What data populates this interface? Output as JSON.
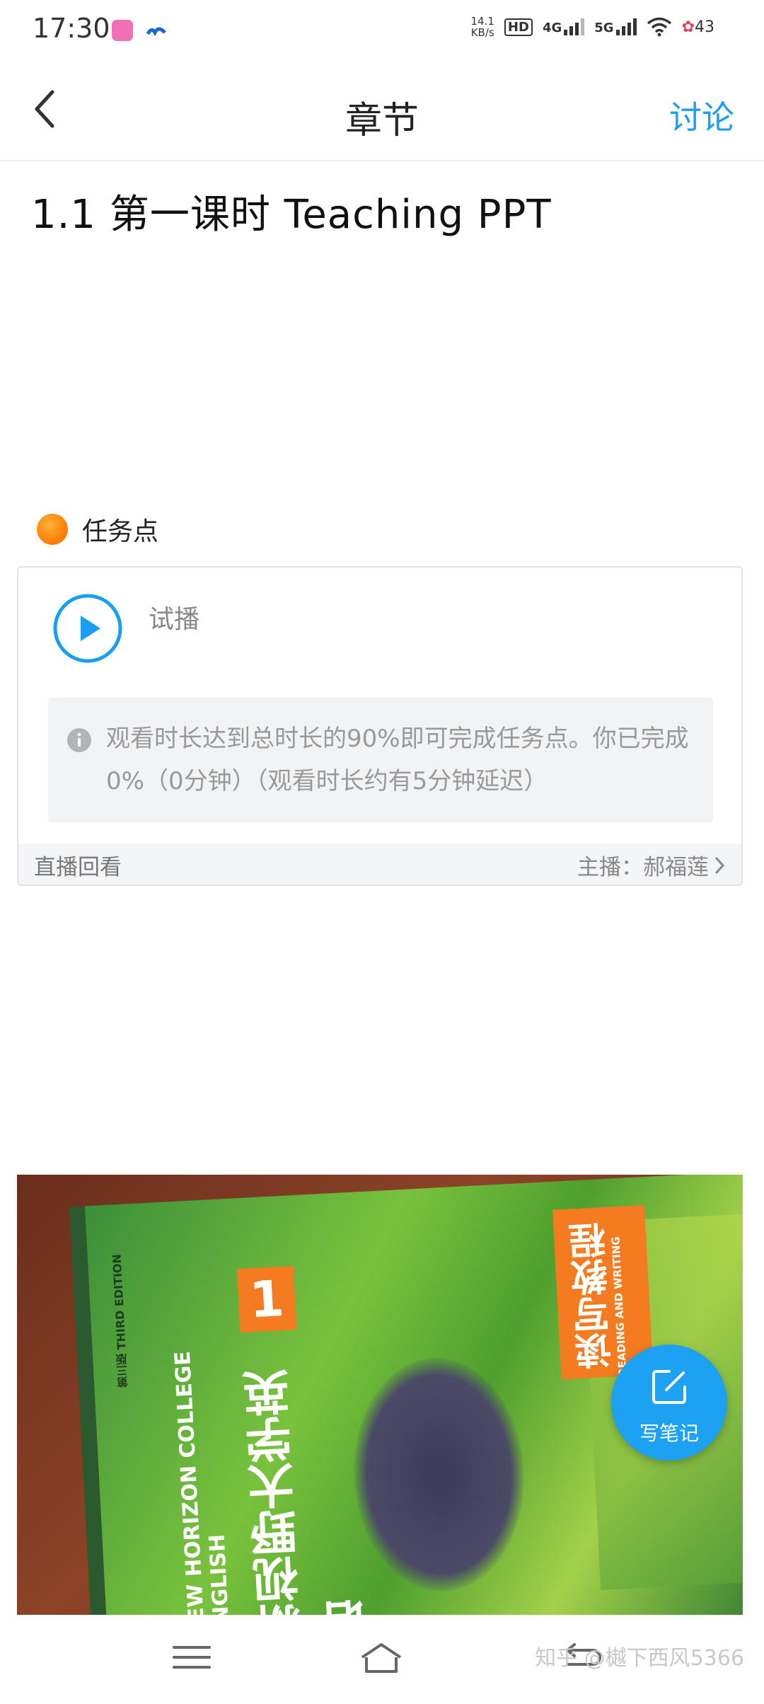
{
  "status_bar": {
    "time": "17:30",
    "net_speed_value": "14.1",
    "net_speed_unit": "KB/s",
    "hd_badge": "HD",
    "network_4g": "4G",
    "network_5g": "5G",
    "battery": "43"
  },
  "header": {
    "title": "章节",
    "discuss_label": "讨论"
  },
  "chapter": {
    "title": "1.1  第一课时  Teaching  PPT"
  },
  "task_point": {
    "label": "任务点"
  },
  "video_card": {
    "title": "试播",
    "notice": "观看时长达到总时长的90%即可完成任务点。你已完成0%（0分钟）（观看时长约有5分钟延迟）",
    "replay_label": "直播回看",
    "host_label": "主播：郝福莲"
  },
  "book_photo": {
    "volume_number": "1",
    "series_title": "新视野大学英语",
    "brand": "NEW HORIZON COLLEGE ENGLISH",
    "course_title": "读写教程",
    "course_subtitle": "READING AND WRITING",
    "edition_label": "第三版 THIRD EDITION"
  },
  "note_button": {
    "label": "写笔记"
  },
  "watermark": "知乎 @樾下西风5366",
  "colors": {
    "accent": "#1a9ef4",
    "task_dot": "#ff8a00",
    "fab": "#1da1f2"
  },
  "icons": [
    "back-icon",
    "play-icon",
    "info-icon",
    "chevron-right-icon",
    "edit-note-icon",
    "menu-icon",
    "home-icon",
    "back-nav-icon"
  ]
}
